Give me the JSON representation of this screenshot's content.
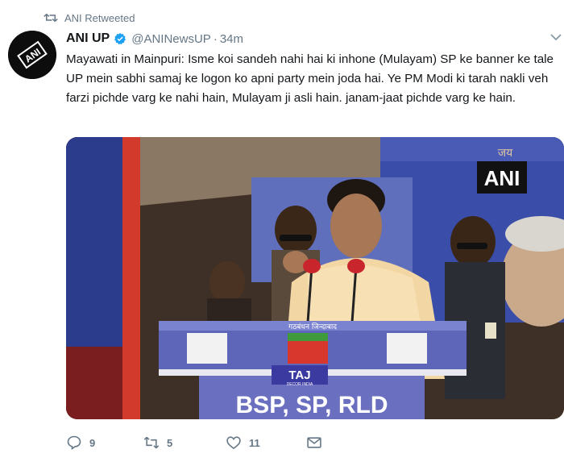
{
  "retweet": {
    "label": "ANI Retweeted"
  },
  "author": {
    "display_name": "ANI UP",
    "handle": "@ANINewsUP",
    "separator": "·",
    "timestamp": "34m",
    "avatar_label": "ANI"
  },
  "tweet": {
    "text": "Mayawati in Mainpuri: Isme koi sandeh nahi hai ki inhone (Mulayam) SP ke banner ke tale UP mein sabhi samaj ke logon ko apni party mein joda hai. Ye PM Modi ki tarah nakli veh farzi pichde varg ke nahi hain, Mulayam ji asli hain. janam-jaat pichde varg ke hain."
  },
  "media": {
    "watermark": "ANI",
    "podium_banner": "BSP, SP, RLD",
    "podium_top_text": "गठबंधन जिन्दाबाद",
    "podium_brand": "TAJ",
    "podium_brand_sub": "DECOR INDIA",
    "background_text": "जय"
  },
  "actions": {
    "reply_count": "9",
    "retweet_count": "5",
    "like_count": "11"
  },
  "colors": {
    "link": "#1da1f2",
    "muted": "#657786",
    "text": "#14171a"
  }
}
